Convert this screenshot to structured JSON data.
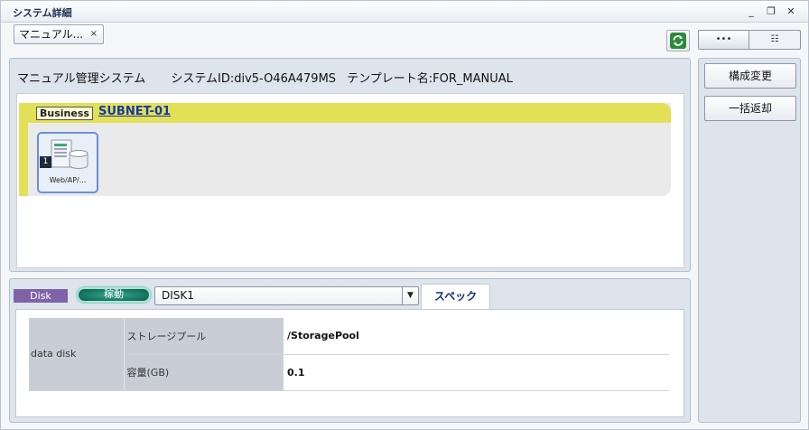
{
  "window": {
    "title": "システム詳細",
    "controls": {
      "minimize": "_",
      "restore": "❐",
      "close": "✕"
    }
  },
  "tabs": [
    {
      "label": "マニュアル...",
      "close": "×"
    }
  ],
  "view_toggle": {
    "option_a": "•••",
    "option_b": "☷"
  },
  "system": {
    "name": "マニュアル管理システム",
    "system_id": "システムID:div5-O46A479MS",
    "template": "テンプレート名:FOR_MANUAL"
  },
  "subnet": {
    "tag": "Business",
    "name": "SUBNET-01",
    "servers": [
      {
        "count": "1",
        "label": "Web/AP/..."
      }
    ]
  },
  "side_actions": [
    {
      "label": "構成変更"
    },
    {
      "label": "一括返却"
    }
  ],
  "disk": {
    "type_badge": "Disk",
    "status": "稼動",
    "selected": "DISK1",
    "spec_tab": "スペック",
    "category": "data disk",
    "rows": [
      {
        "key": "ストレージプール",
        "value": "/StoragePool"
      },
      {
        "key": "容量(GB)",
        "value": "0.1"
      }
    ]
  },
  "colors": {
    "subnet_accent": "#e2e057",
    "status_green": "#157360",
    "disk_badge": "#7e63a8",
    "link": "#1538a8"
  }
}
